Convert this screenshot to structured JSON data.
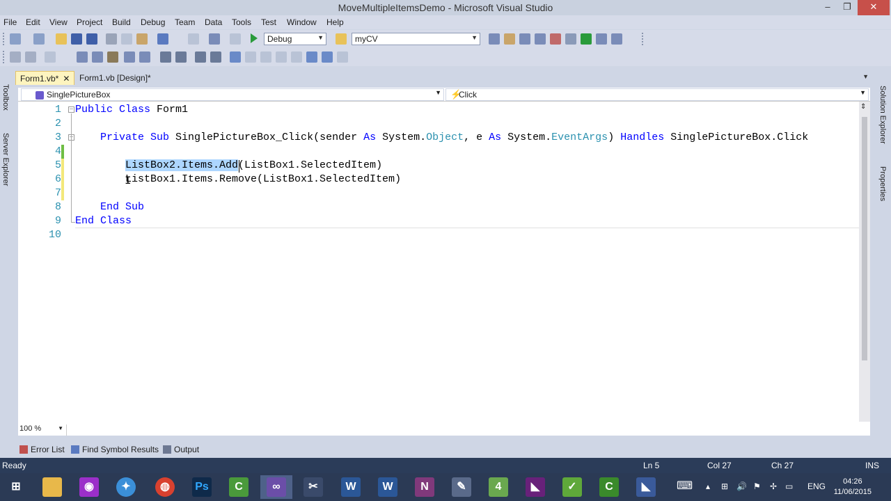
{
  "window": {
    "title": "MoveMultipleItemsDemo - Microsoft Visual Studio"
  },
  "menu": [
    "File",
    "Edit",
    "View",
    "Project",
    "Build",
    "Debug",
    "Team",
    "Data",
    "Tools",
    "Test",
    "Window",
    "Help"
  ],
  "toolbar": {
    "config": "Debug",
    "find": "myCV"
  },
  "tabs": [
    {
      "label": "Form1.vb*",
      "close": "✕"
    },
    {
      "label": "Form1.vb [Design]*"
    }
  ],
  "navbar": {
    "object": "SinglePictureBox",
    "event": "Click"
  },
  "left_rail": [
    "Toolbox",
    "Server Explorer"
  ],
  "right_rail": [
    "Solution Explorer",
    "Properties"
  ],
  "editor": {
    "line_numbers": [
      "1",
      "2",
      "3",
      "4",
      "5",
      "6",
      "7",
      "8",
      "9",
      "10"
    ],
    "code": {
      "l1_kw": "Public Class",
      "l1_name": " Form1",
      "l3_a": "Private Sub",
      "l3_b": " SinglePictureBox_Click(sender ",
      "l3_c": "As",
      "l3_d": " System.",
      "l3_e": "Object",
      "l3_f": ", e ",
      "l3_g": "As",
      "l3_h": " System.",
      "l3_i": "EventArgs",
      "l3_j": ") ",
      "l3_k": "Handles",
      "l3_l": " SinglePictureBox.Click",
      "l5_sel": "ListBox2.Items.Add",
      "l5_rest": "(ListBox1.SelectedItem)",
      "l6": "ListBox1.Items.Remove(ListBox1.SelectedItem)",
      "l8": "End Sub",
      "l9": "End Class"
    },
    "zoom": "100 %"
  },
  "bottom_tabs": [
    "Error List",
    "Find Symbol Results",
    "Output"
  ],
  "status": {
    "ready": "Ready",
    "ln": "Ln 5",
    "col": "Col 27",
    "ch": "Ch 27",
    "ins": "INS"
  },
  "taskbar": {
    "lang": "ENG",
    "time": "04:26",
    "date": "11/06/2015",
    "apps": [
      {
        "name": "start",
        "glyph": "⊞",
        "color": "#2b3a55"
      },
      {
        "name": "file-explorer",
        "glyph": "",
        "color": "#e8b84a"
      },
      {
        "name": "app-purple",
        "glyph": "◉",
        "color": "#9b2fc9"
      },
      {
        "name": "safari",
        "glyph": "✦",
        "color": "#3b8fd8"
      },
      {
        "name": "chrome",
        "glyph": "◍",
        "color": "#d9412f"
      },
      {
        "name": "photoshop",
        "glyph": "Ps",
        "color": "#0f2a4a"
      },
      {
        "name": "camtasia",
        "glyph": "C",
        "color": "#4a9a3b"
      },
      {
        "name": "visual-studio-2012",
        "glyph": "∞",
        "color": "#6b4ea8"
      },
      {
        "name": "snipping-tool",
        "glyph": "✂",
        "color": "#3a4a6a"
      },
      {
        "name": "word",
        "glyph": "W",
        "color": "#2b5797"
      },
      {
        "name": "word-2",
        "glyph": "W",
        "color": "#2b5797"
      },
      {
        "name": "onenote",
        "glyph": "N",
        "color": "#80397b"
      },
      {
        "name": "paint",
        "glyph": "✎",
        "color": "#5a6a8a"
      },
      {
        "name": "app-green",
        "glyph": "4",
        "color": "#6aa84f"
      },
      {
        "name": "visual-studio",
        "glyph": "◣",
        "color": "#68217a"
      },
      {
        "name": "notepad-green",
        "glyph": "✓",
        "color": "#5fa83a"
      },
      {
        "name": "camtasia-2",
        "glyph": "C",
        "color": "#3a8a2b"
      },
      {
        "name": "visual-studio-2013",
        "glyph": "◣",
        "color": "#3a5a9a"
      }
    ]
  },
  "colors": {
    "keyword": "#0000ff",
    "type": "#2b91af",
    "linenum": "#2b91af",
    "status_bg": "#2b3c59",
    "selection": "#add6ff"
  }
}
